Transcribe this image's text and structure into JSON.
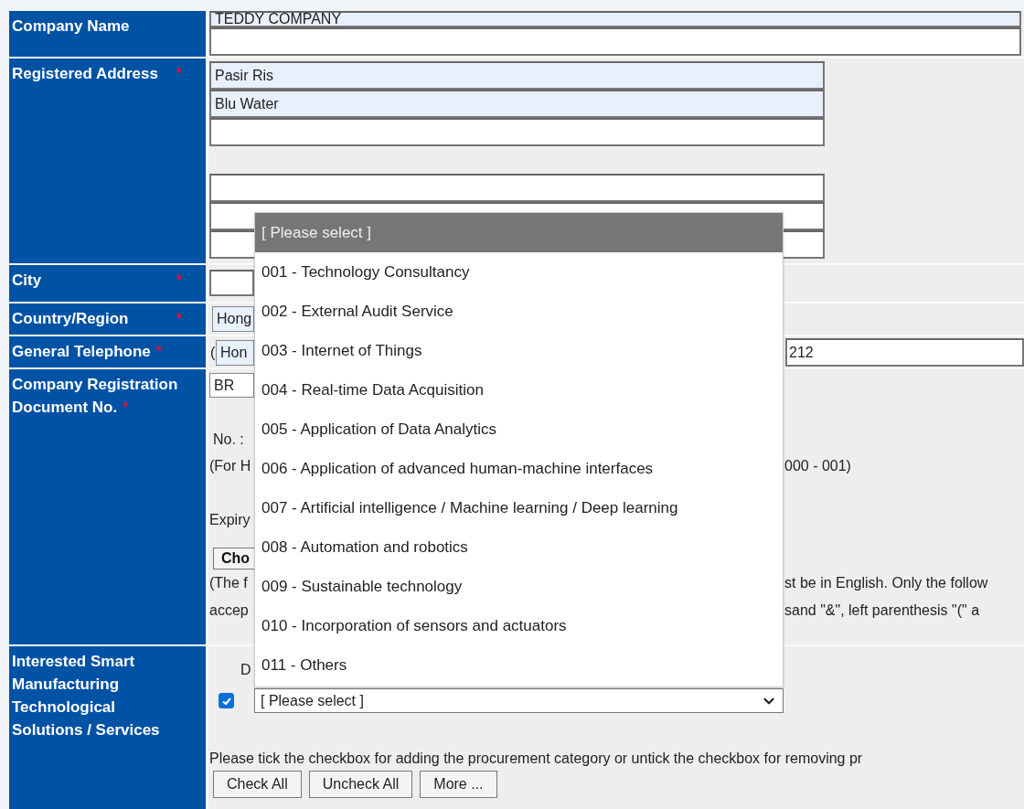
{
  "form": {
    "rows": [
      {
        "kind": "company_name",
        "label": "Company Name",
        "inputs": [
          {
            "value": "TEDDY COMPANY",
            "autofilled": true
          },
          {
            "autofilled": false
          }
        ]
      },
      {
        "kind": "address",
        "label": "Registered Address",
        "mark": "*",
        "groups": [
          [
            {
              "value": "Pasir Ris",
              "autofilled": true
            },
            {
              "value": "Blu Water",
              "autofilled": true
            },
            {
              "autofilled": false
            }
          ],
          [
            {
              "autofilled": false
            },
            {
              "autofilled": false
            },
            {
              "autofilled": false
            }
          ]
        ]
      },
      {
        "kind": "city",
        "label": "City",
        "mark": "*"
      },
      {
        "kind": "country",
        "label": "Country/Region",
        "mark": "*",
        "select_value": "Hong"
      },
      {
        "kind": "telephone",
        "label": "General Telephone",
        "mark": "*",
        "prefix": "(",
        "select_value": "Hon",
        "number": "212"
      },
      {
        "kind": "registration",
        "label": "Company Registration Document No.",
        "mark": "*",
        "select_value": "BR",
        "number_label": "No. :",
        "lines": [
          {
            "left": "(For H",
            "right": "000 - 001)"
          }
        ],
        "expiry_label": "Expiry",
        "file_button": "Cho",
        "note_lines": [
          {
            "left": "(The f",
            "right": "st be in English. Only the follow"
          },
          {
            "left": "accep",
            "right": "sand \"&\", left parenthesis \"(\" a"
          }
        ]
      },
      {
        "kind": "interests",
        "label": "Interested Smart Manufacturing Technological Solutions / Services",
        "column_label": "D",
        "items": [
          {
            "checked": true,
            "select_value": "[ Please select ]"
          }
        ],
        "hint": "Please tick the checkbox for adding the procurement category or untick the checkbox for removing pr",
        "buttons": [
          "Check All",
          "Uncheck All",
          "More ..."
        ]
      }
    ]
  },
  "dropdown": {
    "options": [
      {
        "label": "[ Please select ]",
        "selected": true
      },
      {
        "label": "001 - Technology Consultancy",
        "selected": false
      },
      {
        "label": "002 - External Audit Service",
        "selected": false
      },
      {
        "label": "003 - Internet of Things",
        "selected": false
      },
      {
        "label": "004 - Real-time Data Acquisition",
        "selected": false
      },
      {
        "label": "005 - Application of Data Analytics",
        "selected": false
      },
      {
        "label": "006 - Application of advanced human-machine interfaces",
        "selected": false
      },
      {
        "label": "007 - Artificial intelligence / Machine learning / Deep learning",
        "selected": false
      },
      {
        "label": "008 - Automation and robotics",
        "selected": false
      },
      {
        "label": "009 - Sustainable technology",
        "selected": false
      },
      {
        "label": "010 - Incorporation of sensors and actuators",
        "selected": false
      },
      {
        "label": "011 - Others",
        "selected": false
      }
    ]
  }
}
